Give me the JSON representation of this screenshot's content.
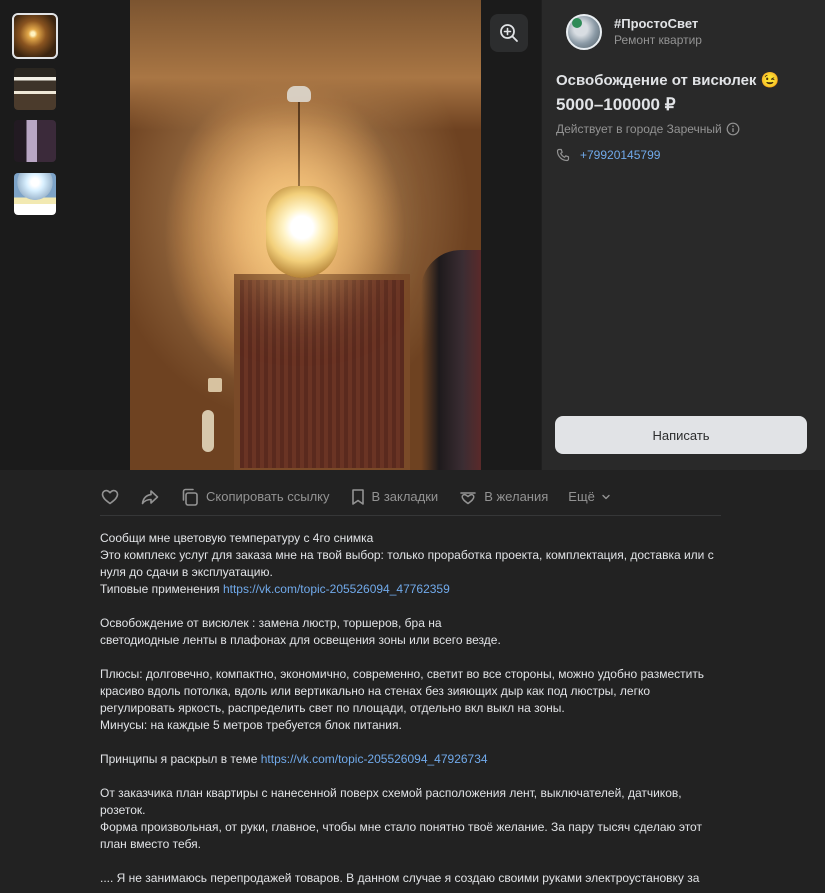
{
  "gallery": {
    "thumbnails": [
      {
        "label": "photo-1-lamp",
        "active": true
      },
      {
        "label": "photo-2-ceiling-lights",
        "active": false
      },
      {
        "label": "photo-3-wall-light",
        "active": false
      },
      {
        "label": "photo-4-color-temperature",
        "active": false
      }
    ],
    "zoom_icon": "zoom-in-icon"
  },
  "seller": {
    "name": "#ПростоСвет",
    "subtitle": "Ремонт квартир"
  },
  "product": {
    "title": "Освобождение от висюлек 😉",
    "price": "5000–100000 ₽",
    "city": "Действует в городе Заречный",
    "phone": "+79920145799",
    "write_button": "Написать"
  },
  "actions": {
    "copy_link": "Скопировать ссылку",
    "bookmarks": "В закладки",
    "wishlist": "В желания",
    "more": "Ещё"
  },
  "description": {
    "p1_l1": "Сообщи мне цветовую температуру с 4го снимка",
    "p1_l2": "Это комплекс услуг для заказа мне на твой выбор: только проработка проекта, комплектация, доставка или с",
    "p1_l3": "нуля до сдачи в эксплуатацию.",
    "p1_l4_text": "Типовые применения ",
    "p1_l4_link": "https://vk.com/topic-205526094_47762359",
    "p2_l1": "Освобождение от висюлек : замена люстр, торшеров, бра на",
    "p2_l2": "светодиодные ленты в плафонах для освещения зоны или всего везде.",
    "p3_l1": "Плюсы: долговечно, компактно, экономично, современно, светит во все стороны, можно удобно разместить",
    "p3_l2": "красиво вдоль потолка, вдоль или вертикально на стенах без зияющих дыр как под люстры, легко",
    "p3_l3": "регулировать яркость, распределить свет по площади, отдельно вкл выкл на зоны.",
    "p3_l4": "Минусы: на каждые 5 метров требуется блок питания.",
    "p4_text": "Принципы я раскрыл в теме ",
    "p4_link": "https://vk.com/topic-205526094_47926734",
    "p5_l1": "От заказчика план квартиры с нанесенной поверх схемой расположения лент, выключателей, датчиков,",
    "p5_l2": "розеток.",
    "p5_l3": "Форма произвольная, от руки, главное, чтобы мне стало понятно твоё желание. За пару тысяч сделаю этот",
    "p5_l4": "план вместо тебя.",
    "p6_l1": ".... Я не занимаюсь перепродажей товаров. В данном случае я создаю своими руками электроустановку за"
  },
  "colors": {
    "background": "#222222",
    "text": "#e1e3e6",
    "secondary": "#939393",
    "link": "#71aaeb",
    "button_bg": "#e1e3e6"
  }
}
